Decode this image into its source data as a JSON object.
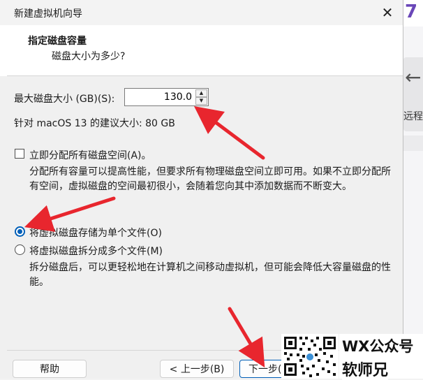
{
  "window": {
    "title": "新建虚拟机向导",
    "close_glyph": "✕"
  },
  "header": {
    "title": "指定磁盘容量",
    "subtitle": "磁盘大小为多少?"
  },
  "disk_size": {
    "label": "最大磁盘大小 (GB)(S):",
    "value": "130.0",
    "recommendation": "针对 macOS 13 的建议大小: 80 GB"
  },
  "allocate": {
    "label": "立即分配所有磁盘空间(A)。",
    "checked": false,
    "description": "分配所有容量可以提高性能，但要求所有物理磁盘空间立即可用。如果不立即分配所有空间，虚拟磁盘的空间最初很小，会随着您向其中添加数据而不断变大。"
  },
  "storage_options": [
    {
      "label": "将虚拟磁盘存储为单个文件(O)",
      "selected": true
    },
    {
      "label": "将虚拟磁盘拆分成多个文件(M)",
      "selected": false
    }
  ],
  "split_description": "拆分磁盘后，可以更轻松地在计算机之间移动虚拟机，但可能会降低大容量磁盘的性能。",
  "buttons": {
    "help": "帮助",
    "back": "< 上一步(B)",
    "next": "下一步("
  },
  "background_app": {
    "brand_digit": "7",
    "arrow_glyph": "←",
    "remote_text": "远程"
  },
  "watermark": {
    "line1": "WX公众号",
    "line2": "软师兄"
  },
  "colors": {
    "accent": "#005fb8",
    "annotation_arrow": "#e8262e",
    "brand_purple": "#6a47b8"
  }
}
